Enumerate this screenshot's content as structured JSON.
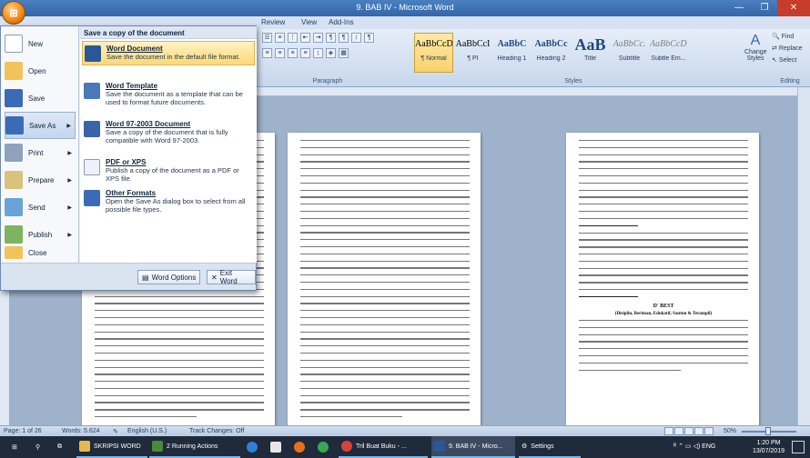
{
  "window": {
    "title": "9. BAB IV - Microsoft Word",
    "controls": [
      "—",
      "❐",
      "✕"
    ]
  },
  "ribbon": {
    "tabs": [
      "Review",
      "View",
      "Add-Ins"
    ],
    "paragraph_label": "Paragraph",
    "styles_label": "Styles",
    "editing_label": "Editing",
    "styles": [
      {
        "sample": "AaBbCcDc",
        "name": "¶ Normal"
      },
      {
        "sample": "AaBbCcI",
        "name": "¶ PI"
      },
      {
        "sample": "AaBbC",
        "name": "Heading 1"
      },
      {
        "sample": "AaBbCc",
        "name": "Heading 2"
      },
      {
        "sample": "AaB",
        "name": "Title"
      },
      {
        "sample": "AaBbCc.",
        "name": "Subtitle"
      },
      {
        "sample": "AaBbCcDı",
        "name": "Subtle Em..."
      }
    ],
    "change_styles": "Change Styles",
    "find": "Find",
    "replace": "Replace",
    "select": "Select"
  },
  "office_menu": {
    "items": [
      {
        "label": "New",
        "icon": "new-document-icon"
      },
      {
        "label": "Open",
        "icon": "open-folder-icon"
      },
      {
        "label": "Save",
        "icon": "save-disk-icon"
      },
      {
        "label": "Save As",
        "icon": "save-as-icon"
      },
      {
        "label": "Print",
        "icon": "printer-icon"
      },
      {
        "label": "Prepare",
        "icon": "prepare-icon"
      },
      {
        "label": "Send",
        "icon": "send-icon"
      },
      {
        "label": "Publish",
        "icon": "publish-icon"
      },
      {
        "label": "Close",
        "icon": "close-folder-icon"
      }
    ],
    "submenu_title": "Save a copy of the document",
    "submenu_items": [
      {
        "title": "Word Document",
        "desc": "Save the document in the default file format."
      },
      {
        "title": "Word Template",
        "desc": "Save the document as a template that can be used to format future documents."
      },
      {
        "title": "Word 97-2003 Document",
        "desc": "Save a copy of the document that is fully compatible with Word 97-2003."
      },
      {
        "title": "PDF or XPS",
        "desc": "Publish a copy of the document as a PDF or XPS file."
      },
      {
        "title": "Other Formats",
        "desc": "Open the Save As dialog box to select from all possible file types."
      }
    ],
    "word_options": "Word Options",
    "exit_word": "Exit Word"
  },
  "document": {
    "heading": "D' BEST",
    "subheading": "(Disiplin, Beriman, Edukatif, Santun & Terampil)",
    "ruler_marker": "18"
  },
  "statusbar": {
    "page": "Page: 1 of 26",
    "words": "Words: 5.624",
    "language": "English (U.S.)",
    "track_changes": "Track Changes: Off",
    "zoom": "50%"
  },
  "taskbar": {
    "items": [
      {
        "label": "",
        "icon": "windows-start-icon"
      },
      {
        "label": "",
        "icon": "search-icon"
      },
      {
        "label": "",
        "icon": "task-view-icon"
      },
      {
        "label": "SKRIPSI WORD",
        "icon": "folder-icon"
      },
      {
        "label": "2 Running Actions",
        "icon": "actions-icon"
      },
      {
        "label": "",
        "icon": "edge-icon"
      },
      {
        "label": "",
        "icon": "store-icon"
      },
      {
        "label": "",
        "icon": "firefox-icon"
      },
      {
        "label": "",
        "icon": "chrome-icon"
      },
      {
        "label": "Tril Buat Buku - ...",
        "icon": "chrome-window-icon"
      },
      {
        "label": "9. BAB IV - Micro...",
        "icon": "word-icon"
      },
      {
        "label": "Settings",
        "icon": "settings-gear-icon"
      }
    ],
    "language": "ENG",
    "time": "1:20 PM",
    "date": "13/07/2019"
  }
}
